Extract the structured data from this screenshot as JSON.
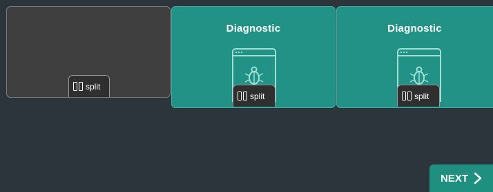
{
  "tiles": [
    {
      "title": "",
      "split_label": "split"
    },
    {
      "title": "Diagnostic",
      "split_label": "split"
    },
    {
      "title": "Diagnostic",
      "split_label": "split"
    }
  ],
  "next_label": "NEXT",
  "colors": {
    "background": "#2b353b",
    "empty_tile": "#3f3f3f",
    "diagnostic_tile": "#219285",
    "next_button": "#1f8f7f"
  },
  "icons": [
    "split-icon",
    "browser-bug-icon",
    "chevron-right-icon"
  ]
}
